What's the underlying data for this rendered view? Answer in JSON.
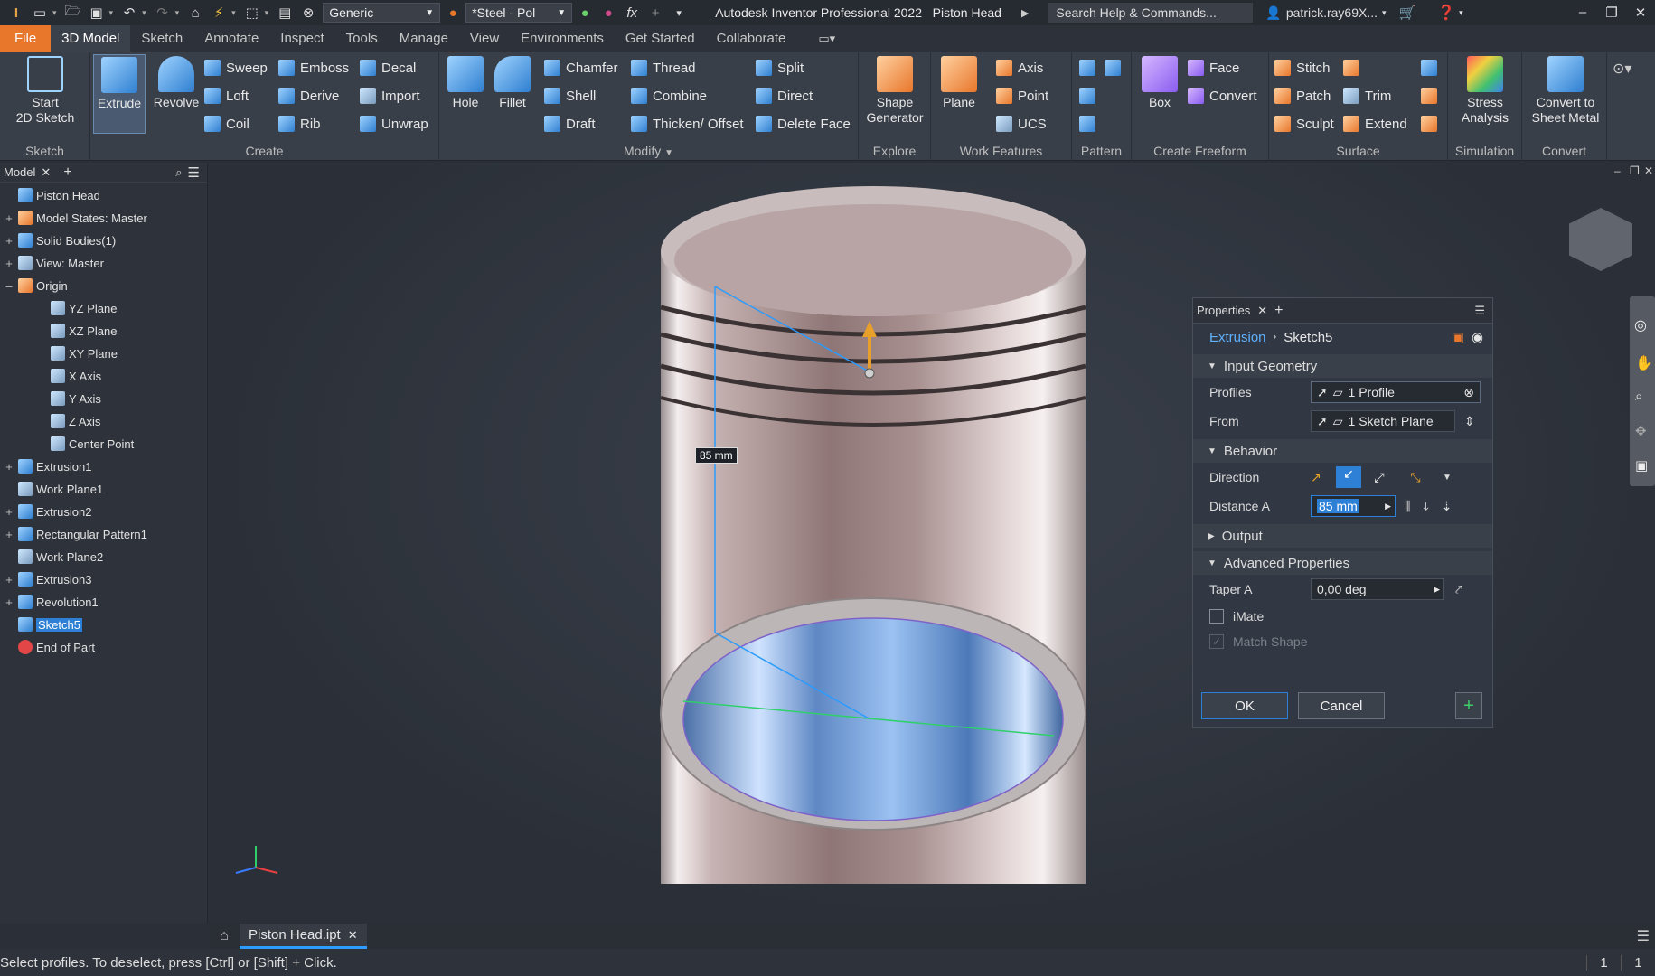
{
  "titlebar": {
    "material": "Generic",
    "appearance": "*Steel - Pol",
    "app_title": "Autodesk Inventor Professional 2022",
    "doc_title": "Piston Head",
    "search_placeholder": "Search Help & Commands...",
    "user": "patrick.ray69X..."
  },
  "menu": [
    "File",
    "3D Model",
    "Sketch",
    "Annotate",
    "Inspect",
    "Tools",
    "Manage",
    "View",
    "Environments",
    "Get Started",
    "Collaborate"
  ],
  "ribbon": {
    "sketch": {
      "label": "Sketch",
      "start": "Start\n2D Sketch"
    },
    "create": {
      "label": "Create",
      "extrude": "Extrude",
      "revolve": "Revolve",
      "sweep": "Sweep",
      "loft": "Loft",
      "coil": "Coil",
      "emboss": "Emboss",
      "derive": "Derive",
      "rib": "Rib",
      "decal": "Decal",
      "import": "Import",
      "unwrap": "Unwrap"
    },
    "modify": {
      "label": "Modify",
      "hole": "Hole",
      "fillet": "Fillet",
      "chamfer": "Chamfer",
      "shell": "Shell",
      "draft": "Draft",
      "thread": "Thread",
      "combine": "Combine",
      "thicken": "Thicken/ Offset",
      "split": "Split",
      "direct": "Direct",
      "delete_face": "Delete Face"
    },
    "explore": {
      "label": "Explore",
      "shape": "Shape\nGenerator"
    },
    "work": {
      "label": "Work Features",
      "plane": "Plane",
      "axis": "Axis",
      "point": "Point",
      "ucs": "UCS"
    },
    "pattern": {
      "label": "Pattern"
    },
    "freeform": {
      "label": "Create Freeform",
      "box": "Box",
      "face": "Face",
      "convert": "Convert"
    },
    "surface": {
      "label": "Surface",
      "stitch": "Stitch",
      "patch": "Patch",
      "sculpt": "Sculpt",
      "trim": "Trim",
      "extend": "Extend"
    },
    "simulation": {
      "label": "Simulation",
      "stress": "Stress\nAnalysis"
    },
    "convert": {
      "label": "Convert",
      "sheet": "Convert to\nSheet Metal"
    }
  },
  "browser": {
    "tab": "Model",
    "nodes": [
      {
        "label": "Piston Head"
      },
      {
        "label": "Model States: Master"
      },
      {
        "label": "Solid Bodies(1)"
      },
      {
        "label": "View: Master"
      },
      {
        "label": "Origin"
      },
      {
        "label": "YZ Plane"
      },
      {
        "label": "XZ Plane"
      },
      {
        "label": "XY Plane"
      },
      {
        "label": "X Axis"
      },
      {
        "label": "Y Axis"
      },
      {
        "label": "Z Axis"
      },
      {
        "label": "Center Point"
      },
      {
        "label": "Extrusion1"
      },
      {
        "label": "Work Plane1"
      },
      {
        "label": "Extrusion2"
      },
      {
        "label": "Rectangular Pattern1"
      },
      {
        "label": "Work Plane2"
      },
      {
        "label": "Extrusion3"
      },
      {
        "label": "Revolution1"
      },
      {
        "label": "Sketch5"
      },
      {
        "label": "End of Part"
      }
    ]
  },
  "viewport": {
    "dim_label": "85 mm"
  },
  "properties": {
    "tab": "Properties",
    "crumb_feature": "Extrusion",
    "crumb_sketch": "Sketch5",
    "input_geometry": "Input Geometry",
    "profiles_label": "Profiles",
    "profiles_value": "1 Profile",
    "from_label": "From",
    "from_value": "1 Sketch Plane",
    "behavior": "Behavior",
    "direction_label": "Direction",
    "distance_label": "Distance A",
    "distance_value": "85 mm",
    "output": "Output",
    "advanced": "Advanced Properties",
    "taper_label": "Taper A",
    "taper_value": "0,00 deg",
    "imate": "iMate",
    "match_shape": "Match Shape",
    "ok": "OK",
    "cancel": "Cancel"
  },
  "doctab": "Piston Head.ipt",
  "status": {
    "message": "Select profiles. To deselect, press [Ctrl] or [Shift] + Click.",
    "count1": "1",
    "count2": "1"
  }
}
